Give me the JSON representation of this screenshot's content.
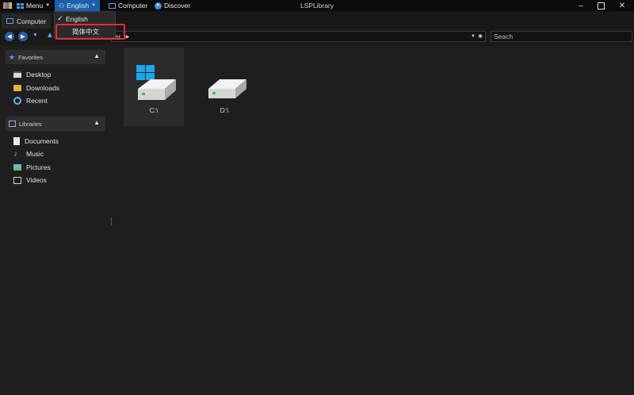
{
  "titlebar": {
    "menu_label": "Menu",
    "language_label": "English",
    "computer_label": "Computer",
    "discover_label": "Discover",
    "app_title": "LSPLibrary"
  },
  "tabs": [
    {
      "label": "Computer"
    }
  ],
  "language_menu": {
    "items": [
      {
        "label": "English",
        "checked": true
      },
      {
        "label": "简体中文",
        "checked": false,
        "highlighted": true
      }
    ]
  },
  "address": {
    "visible_text": "er",
    "search_value": "Seach"
  },
  "sidebar": {
    "favorites": {
      "title": "Favorites",
      "items": [
        {
          "label": "Desktop",
          "icon": "desktop-icon"
        },
        {
          "label": "Downloads",
          "icon": "downloads-icon"
        },
        {
          "label": "Recent",
          "icon": "recent-icon"
        }
      ]
    },
    "libraries": {
      "title": "Libraries",
      "items": [
        {
          "label": "Documents",
          "icon": "documents-icon"
        },
        {
          "label": "Music",
          "icon": "music-icon"
        },
        {
          "label": "Pictures",
          "icon": "pictures-icon"
        },
        {
          "label": "Videos",
          "icon": "videos-icon"
        }
      ]
    }
  },
  "drives": [
    {
      "label": "C:\\",
      "icon": "system-drive-icon",
      "selected": true
    },
    {
      "label": "D:\\",
      "icon": "drive-icon",
      "selected": false
    }
  ],
  "colors": {
    "accent": "#1c5fae",
    "highlight_outline": "#e8283c",
    "windows_logo": "#1aa7e8"
  }
}
